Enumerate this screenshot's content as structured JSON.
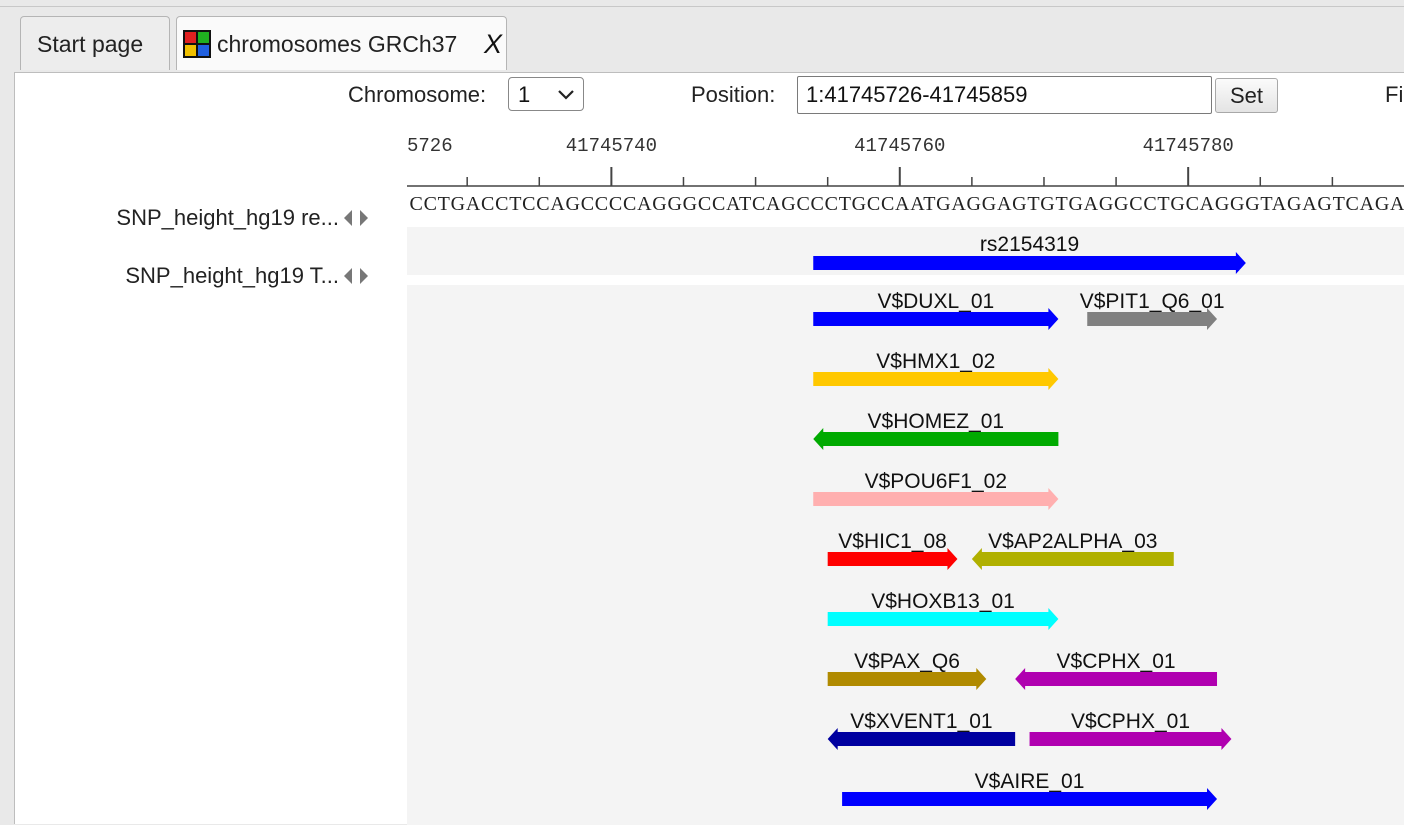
{
  "tabs": [
    {
      "label": "Start page"
    },
    {
      "label": "chromosomes GRCh37",
      "close": "X",
      "icon": "genome-app-icon"
    }
  ],
  "toolbar": {
    "chromosome_label": "Chromosome:",
    "chromosome_value": "1",
    "position_label": "Position:",
    "position_value": "1:41745726-41745859",
    "set_label": "Set",
    "fit_label": "Fi"
  },
  "ruler": {
    "start": 41745726,
    "tick_labels": [
      "5726",
      "41745740",
      "41745760",
      "41745780"
    ],
    "tick_positions": [
      41745726,
      41745740,
      41745760,
      41745780
    ]
  },
  "sequence": "CCTGACCTCCAGCCCCAGGGCCATCAGCCCTGCCAATGAGGAGTGTGAGGCCTGCAGGGTAGAGTCAGA",
  "tracks": [
    {
      "label": "SNP_height_hg19 re...",
      "items": [
        {
          "name": "rs2154319",
          "start": 41745754,
          "end": 41745784,
          "strand": "+",
          "color": "#0000ff"
        }
      ]
    },
    {
      "label": "SNP_height_hg19 T...",
      "items": [
        {
          "name": "V$DUXL_01",
          "start": 41745754,
          "end": 41745771,
          "strand": "+",
          "color": "#0000ff"
        },
        {
          "name": "V$PIT1_Q6_01",
          "start": 41745773,
          "end": 41745782,
          "strand": "+",
          "color": "#808080"
        },
        {
          "name": "V$HMX1_02",
          "start": 41745754,
          "end": 41745771,
          "strand": "+",
          "color": "#ffc800"
        },
        {
          "name": "V$HOMEZ_01",
          "start": 41745754,
          "end": 41745771,
          "strand": "-",
          "color": "#00aa00"
        },
        {
          "name": "V$POU6F1_02",
          "start": 41745754,
          "end": 41745771,
          "strand": "+",
          "color": "#ffafaf"
        },
        {
          "name": "V$HIC1_08",
          "start": 41745755,
          "end": 41745764,
          "strand": "+",
          "color": "#ff0000"
        },
        {
          "name": "V$AP2ALPHA_03",
          "start": 41745765,
          "end": 41745779,
          "strand": "-",
          "color": "#b0b000"
        },
        {
          "name": "V$HOXB13_01",
          "start": 41745755,
          "end": 41745771,
          "strand": "+",
          "color": "#00ffff"
        },
        {
          "name": "V$PAX_Q6",
          "start": 41745755,
          "end": 41745766,
          "strand": "+",
          "color": "#b08a00"
        },
        {
          "name": "V$CPHX_01",
          "start": 41745768,
          "end": 41745782,
          "strand": "-",
          "color": "#b000b0"
        },
        {
          "name": "V$XVENT1_01",
          "start": 41745755,
          "end": 41745768,
          "strand": "-",
          "color": "#0000a0"
        },
        {
          "name": "V$CPHX_01",
          "start": 41745769,
          "end": 41745783,
          "strand": "+",
          "color": "#b000b0"
        },
        {
          "name": "V$AIRE_01",
          "start": 41745756,
          "end": 41745782,
          "strand": "+",
          "color": "#0000ff"
        }
      ]
    }
  ]
}
